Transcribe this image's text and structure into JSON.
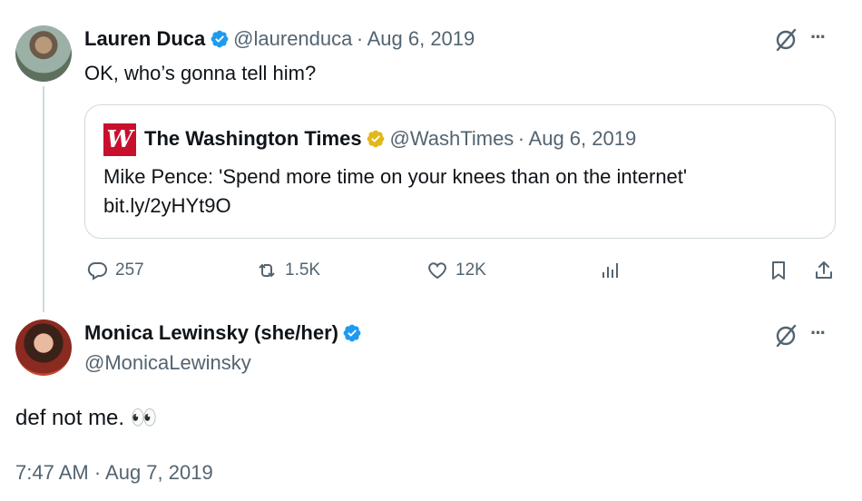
{
  "colors": {
    "verified_blue": "#1d9bf0",
    "gold_badge": "#e2b719",
    "muted": "#536471",
    "border": "#cfd9de",
    "wash_red": "#c8102e"
  },
  "tweet1": {
    "display_name": "Lauren Duca",
    "handle": "@laurenduca",
    "separator": "·",
    "date": "Aug 6, 2019",
    "text": "OK, who’s gonna tell him?",
    "verified": true,
    "more_label": "···",
    "quote": {
      "display_name": "The Washington Times",
      "handle": "@WashTimes",
      "separator": "·",
      "date": "Aug 6, 2019",
      "text": "Mike Pence: 'Spend more time on your knees than on the internet'",
      "link": "bit.ly/2yHYt9O",
      "logo_letters": "W",
      "verified": "gold"
    },
    "actions": {
      "replies": "257",
      "retweets": "1.5K",
      "likes": "12K"
    }
  },
  "tweet2": {
    "display_name": "Monica Lewinsky (she/her)",
    "handle": "@MonicaLewinsky",
    "verified": true,
    "more_label": "···",
    "text": "def not me.",
    "emoji": "👀",
    "timestamp": "7:47 AM · Aug 7, 2019"
  },
  "icons": [
    "grok-icon",
    "more-icon",
    "reply-icon",
    "retweet-icon",
    "like-icon",
    "views-icon",
    "bookmark-icon",
    "share-icon",
    "verified-badge-icon"
  ]
}
